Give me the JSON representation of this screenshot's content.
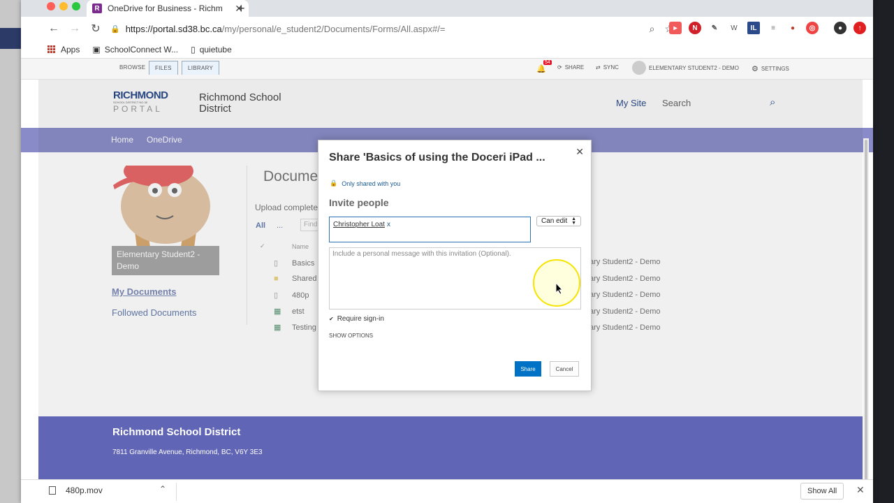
{
  "browser": {
    "tab_title": "OneDrive for Business - Richm",
    "tab_favicon_letter": "R",
    "url_host": "https://portal.sd38.bc.ca",
    "url_path": "/my/personal/e_student2/Documents/Forms/All.aspx#/=",
    "bookmarks": [
      {
        "label": "Apps"
      },
      {
        "label": "SchoolConnect W..."
      },
      {
        "label": "quietube"
      }
    ]
  },
  "ribbon": {
    "tabs": [
      "BROWSE",
      "FILES",
      "LIBRARY"
    ],
    "notification_count": "54",
    "share": "SHARE",
    "sync": "SYNC",
    "user": "ELEMENTARY STUDENT2 - DEMO",
    "settings": "SETTINGS"
  },
  "header": {
    "logo_main": "RICHMOND",
    "logo_sub": "SCHOOL DISTRICT NO.38",
    "logo_portal": "PORTAL",
    "site_title": "Richmond School District",
    "my_site": "My Site",
    "search_placeholder": "Search"
  },
  "nav": {
    "home": "Home",
    "onedrive": "OneDrive"
  },
  "sidebar": {
    "user_name": "Elementary Student2 - Demo",
    "my_documents": "My Documents",
    "followed_documents": "Followed Documents"
  },
  "main": {
    "title": "Docume",
    "upload_text": "Upload complete",
    "view_all": "All",
    "view_more": "...",
    "find_placeholder": "Find",
    "col_name": "Name",
    "files": [
      {
        "name": "Basics",
        "modified_by": "ary Student2 - Demo",
        "icon": "document-icon"
      },
      {
        "name": "Shared",
        "modified_by": "ary Student2 - Demo",
        "icon": "folder-icon"
      },
      {
        "name": "480p",
        "modified_by": "ary Student2 - Demo",
        "icon": "document-icon"
      },
      {
        "name": "etst",
        "modified_by": "ary Student2 - Demo",
        "icon": "excel-icon"
      },
      {
        "name": "Testing",
        "modified_by": "ary Student2 - Demo",
        "icon": "excel-icon"
      }
    ]
  },
  "footer": {
    "title": "Richmond School District",
    "address": "7811 Granville Avenue, Richmond, BC, V6Y 3E3"
  },
  "modal": {
    "title": "Share 'Basics of using the Doceri iPad ...",
    "shared_note": "Only shared with you",
    "invite_title": "Invite people",
    "invitee": "Christopher Loat",
    "invitee_remove": "x",
    "permission": "Can edit",
    "message_placeholder": "Include a personal message with this invitation (Optional).",
    "require_signin": "Require sign-in",
    "show_options": "SHOW OPTIONS",
    "share_button": "Share",
    "cancel_button": "Cancel"
  },
  "downloads": {
    "file": "480p.mov",
    "show_all": "Show All"
  },
  "colors": {
    "nav_purple": "#6165b5",
    "share_blue": "#0072c6",
    "highlight_yellow": "#f5e400"
  }
}
